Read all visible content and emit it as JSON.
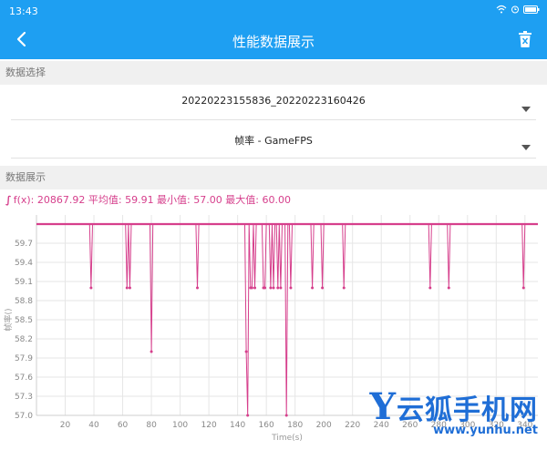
{
  "status_bar": {
    "time": "13:43",
    "icons": [
      "wifi-icon",
      "alarm-icon",
      "battery-icon"
    ]
  },
  "app_bar": {
    "title": "性能数据展示",
    "back_icon": "chevron-left-icon",
    "delete_icon": "trash-icon"
  },
  "data_selection": {
    "header": "数据选择",
    "file_select": {
      "value": "20220223155836_20220223160426"
    },
    "metric_select": {
      "value": "帧率 - GameFPS"
    }
  },
  "data_display": {
    "header": "数据展示",
    "stats_prefix": "∫",
    "stats": "f(x): 20867.92 平均值: 59.91 最小值: 57.00 最大值: 60.00"
  },
  "chart_data": {
    "type": "line",
    "xlabel": "Time(s)",
    "ylabel": "帧率()",
    "xlim": [
      0,
      349
    ],
    "ylim": [
      57.0,
      60.0
    ],
    "x_ticks": [
      20,
      40,
      60,
      80,
      100,
      120,
      140,
      160,
      180,
      200,
      220,
      240,
      260,
      280,
      300,
      320,
      340
    ],
    "x_tick_labels": [
      "20",
      "40",
      "60",
      "80",
      "100",
      "120",
      "140",
      "160",
      "180",
      "200",
      "220",
      "240",
      "260",
      "280",
      "300",
      "320",
      "340"
    ],
    "y_ticks": [
      57.0,
      57.3,
      57.6,
      57.9,
      58.2,
      58.5,
      58.8,
      59.1,
      59.4,
      59.7
    ],
    "y_tick_labels": [
      "57.0",
      "57.3",
      "57.6",
      "57.9",
      "58.2",
      "58.5",
      "58.8",
      "59.1",
      "59.4",
      "59.7"
    ],
    "grid": true,
    "color": "#d63f8c",
    "series": [
      {
        "dips": [
          {
            "x": 38,
            "y": 59.0
          },
          {
            "x": 63,
            "y": 59.0
          },
          {
            "x": 65,
            "y": 59.0
          },
          {
            "x": 80,
            "y": 58.0
          },
          {
            "x": 112,
            "y": 59.0
          },
          {
            "x": 146,
            "y": 58.0
          },
          {
            "x": 147,
            "y": 57.0
          },
          {
            "x": 149,
            "y": 59.0
          },
          {
            "x": 150,
            "y": 59.0
          },
          {
            "x": 152,
            "y": 59.0
          },
          {
            "x": 158,
            "y": 59.0
          },
          {
            "x": 159,
            "y": 59.0
          },
          {
            "x": 163,
            "y": 59.0
          },
          {
            "x": 165,
            "y": 59.0
          },
          {
            "x": 168,
            "y": 59.0
          },
          {
            "x": 170,
            "y": 59.0
          },
          {
            "x": 174,
            "y": 57.0
          },
          {
            "x": 177,
            "y": 59.0
          },
          {
            "x": 192,
            "y": 59.0
          },
          {
            "x": 199,
            "y": 59.0
          },
          {
            "x": 214,
            "y": 59.0
          },
          {
            "x": 274,
            "y": 59.0
          },
          {
            "x": 287,
            "y": 59.0
          },
          {
            "x": 339,
            "y": 59.0
          }
        ],
        "baseline": 60.0
      }
    ]
  },
  "watermark": {
    "main": "云狐手机网",
    "y_letter": "Y",
    "url": "www.yunhu.net"
  }
}
